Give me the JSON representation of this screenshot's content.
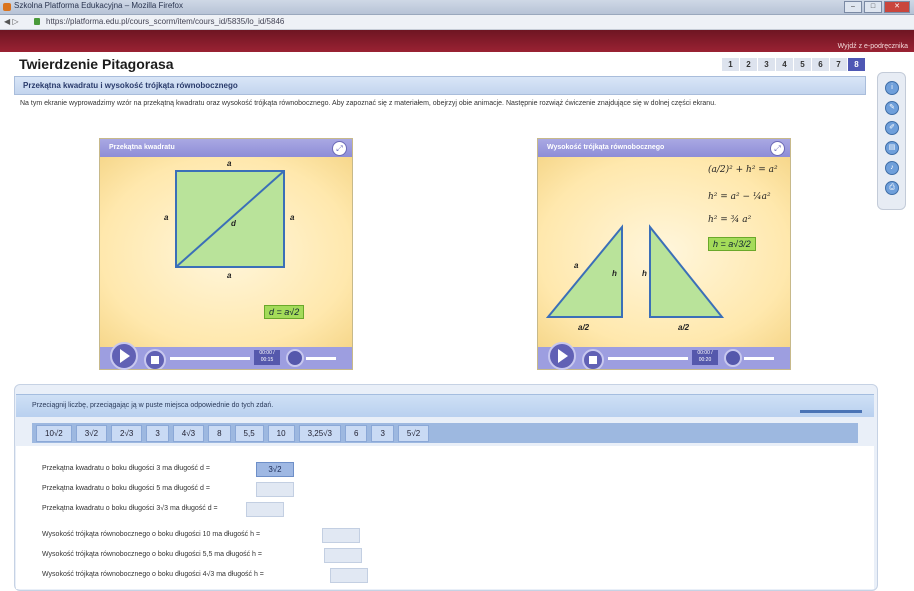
{
  "window": {
    "title": "Szkolna Platforma Edukacyjna – Mozilla Firefox",
    "controls": [
      "–",
      "□",
      "✕"
    ]
  },
  "address": {
    "nav": "◀ ▷",
    "url": "https://platforma.edu.pl/cours_scorm/item/cours_id/5835/lo_id/5846"
  },
  "topbar": {
    "link": "Wyjdź z e-podręcznika"
  },
  "page": {
    "title": "Twierdzenie Pitagorasa",
    "pages": [
      "1",
      "2",
      "3",
      "4",
      "5",
      "6",
      "7",
      "8"
    ],
    "active_page": "8"
  },
  "section": {
    "header": "Przekątna kwadratu i wysokość trójkąta równobocznego",
    "intro": "Na tym ekranie wyprowadzimy wzór na przekątną kwadratu oraz wysokość trójkąta równobocznego. Aby zapoznać się z materiałem, obejrzyj obie animacje. Następnie rozwiąż ćwiczenie znajdujące się w dolnej części ekranu."
  },
  "sidebar": {
    "tools": [
      {
        "icon": "info-icon",
        "glyph": "i"
      },
      {
        "icon": "pencil-icon",
        "glyph": "✎"
      },
      {
        "icon": "eraser-icon",
        "glyph": "✐"
      },
      {
        "icon": "notes-icon",
        "glyph": "▤"
      },
      {
        "icon": "sound-icon",
        "glyph": "♪"
      },
      {
        "icon": "print-icon",
        "glyph": "⎙"
      }
    ]
  },
  "panel_square": {
    "title": "Przekątna kwadratu",
    "side_label": "a",
    "diag_label": "d",
    "result": "d = a√2",
    "time": "00:00 / 00:15"
  },
  "panel_triangle": {
    "title": "Wysokość trójkąta równobocznego",
    "side_label": "a",
    "height_label": "h",
    "base_half": "a/2",
    "f1": "(a/2)² + h² = a²",
    "f2": "h² = a² − ¼a²",
    "f3": "h² = ¾ a²",
    "result": "h = a√3/2",
    "time": "00:00 / 00:20"
  },
  "exercise": {
    "instruction": "Przeciągnij liczbę, przeciągając ją w puste miejsca odpowiednie do tych zdań.",
    "chips": [
      "10√2",
      "3√2",
      "2√3",
      "3",
      "4√3",
      "8",
      "5,5",
      "10",
      "3,25√3",
      "6",
      "3",
      "5√2"
    ],
    "questions": [
      {
        "text": "Przekątna kwadratu o boku długości 3 ma długość d =",
        "answer": "3√2"
      },
      {
        "text": "Przekątna kwadratu o boku długości 5 ma długość d =",
        "answer": ""
      },
      {
        "text": "Przekątna kwadratu o boku długości 3√3 ma długość d =",
        "answer": ""
      },
      {
        "text": "Wysokość trójkąta równobocznego o boku długości 10 ma długość h =",
        "answer": ""
      },
      {
        "text": "Wysokość trójkąta równobocznego o boku długości 5,5 ma długość h =",
        "answer": ""
      },
      {
        "text": "Wysokość trójkąta równobocznego o boku długości 4√3 ma długość h =",
        "answer": ""
      }
    ]
  },
  "colors": {
    "brand_red": "#8a1d2c",
    "panel_header": "#9897dc",
    "answer_green": "#a4db59",
    "shape_fill": "#b9e39a"
  }
}
